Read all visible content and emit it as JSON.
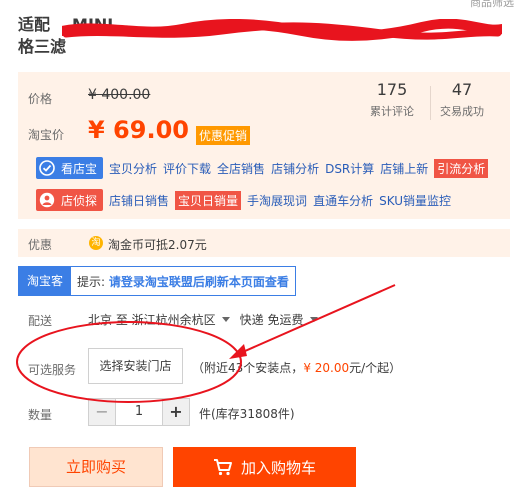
{
  "top_cut_text": "商品筛选",
  "title": {
    "line1_visible_start": "适配",
    "line1_visible_tail": "MINI",
    "line1_end": "，",
    "line2": "格三滤"
  },
  "price_box": {
    "price_label": "价格",
    "original_price": "¥ 400.00",
    "reviews_count": "175",
    "reviews_label": "累计评论",
    "trades_count": "47",
    "trades_label": "交易成功",
    "taobao_price_label": "淘宝价",
    "taobao_price": "¥ 69.00",
    "promo_tag": "优惠促销"
  },
  "tools": {
    "kandianbao_label": "看店宝",
    "kandianbao_links": [
      "宝贝分析",
      "评价下载",
      "全店销售",
      "店铺分析",
      "DSR计算",
      "店铺上新"
    ],
    "kandianbao_highlight": "引流分析",
    "dianzhentan_label": "店侦探",
    "dianzhentan_link1": "店铺日销售",
    "dianzhentan_highlight": "宝贝日销量",
    "dianzhentan_links": [
      "手淘展现词",
      "直通车分析",
      "SKU销量监控"
    ]
  },
  "promo": {
    "label": "优惠",
    "coin_icon": "淘",
    "text": "淘金币可抵2.07元"
  },
  "taobaoke": {
    "badge": "淘宝客",
    "prefix": "提示:",
    "bold_text": "请登录淘宝联盟后刷新本页面查看"
  },
  "shipping": {
    "label": "配送",
    "from": "北京 至",
    "to": "浙江杭州余杭区",
    "method": "快递 免运费"
  },
  "service": {
    "label": "可选服务",
    "button": "选择安装门店",
    "note_prefix": "（附近",
    "note_count": "43",
    "note_mid": "个安装点，",
    "note_price": "¥ 20.00",
    "note_suffix": "元/个起）"
  },
  "quantity": {
    "label": "数量",
    "minus": "−",
    "value": "1",
    "plus": "+",
    "stock": "件(库存31808件)"
  },
  "actions": {
    "buy_now": "立即购买",
    "add_to_cart": "加入购物车"
  },
  "colors": {
    "accent": "#ff4400",
    "tool_blue": "#3b7ee5",
    "tool_red": "#f05545",
    "annotation_red": "#e8141e",
    "price_bg": "#fff2e8"
  }
}
